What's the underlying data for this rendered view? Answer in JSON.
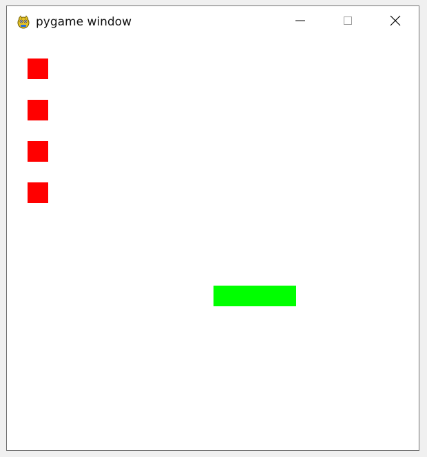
{
  "window": {
    "title": "pygame window",
    "app_icon": "pygame-snake-icon",
    "controls": [
      {
        "name": "minimize",
        "icon": "minimize-icon"
      },
      {
        "name": "maximize",
        "icon": "maximize-icon"
      },
      {
        "name": "close",
        "icon": "close-icon"
      }
    ]
  },
  "game": {
    "background_color": "#ffffff",
    "block_color": "#ff0000",
    "paddle_color": "#00ff00",
    "red_blocks_count": 4
  }
}
